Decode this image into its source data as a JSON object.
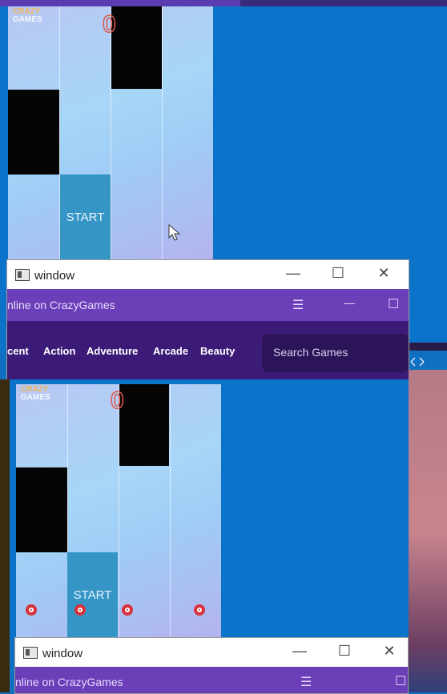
{
  "game": {
    "score": "0",
    "start_label": "START",
    "logo_line1": "CRAZY",
    "logo_line2": "GAMES"
  },
  "window1": {
    "title": "window",
    "minimize": "—",
    "maximize": "☐",
    "close": "✕"
  },
  "browser": {
    "tab_text": "nline on CrazyGames",
    "menu_icon": "☰",
    "minimize": "—",
    "maximize": "☐"
  },
  "nav": {
    "items": [
      "cent",
      "Action",
      "Adventure",
      "Arcade",
      "Beauty"
    ],
    "search_placeholder": "Search Games"
  },
  "window2": {
    "title": "window",
    "minimize": "—",
    "maximize": "☐",
    "close": "✕",
    "tab_text": "nline on CrazyGames"
  },
  "colors": {
    "accent_purple": "#6a3fb7",
    "nav_dark": "#3c1b78",
    "tile_blue": "#3596c6",
    "score_red": "#e0574a"
  }
}
